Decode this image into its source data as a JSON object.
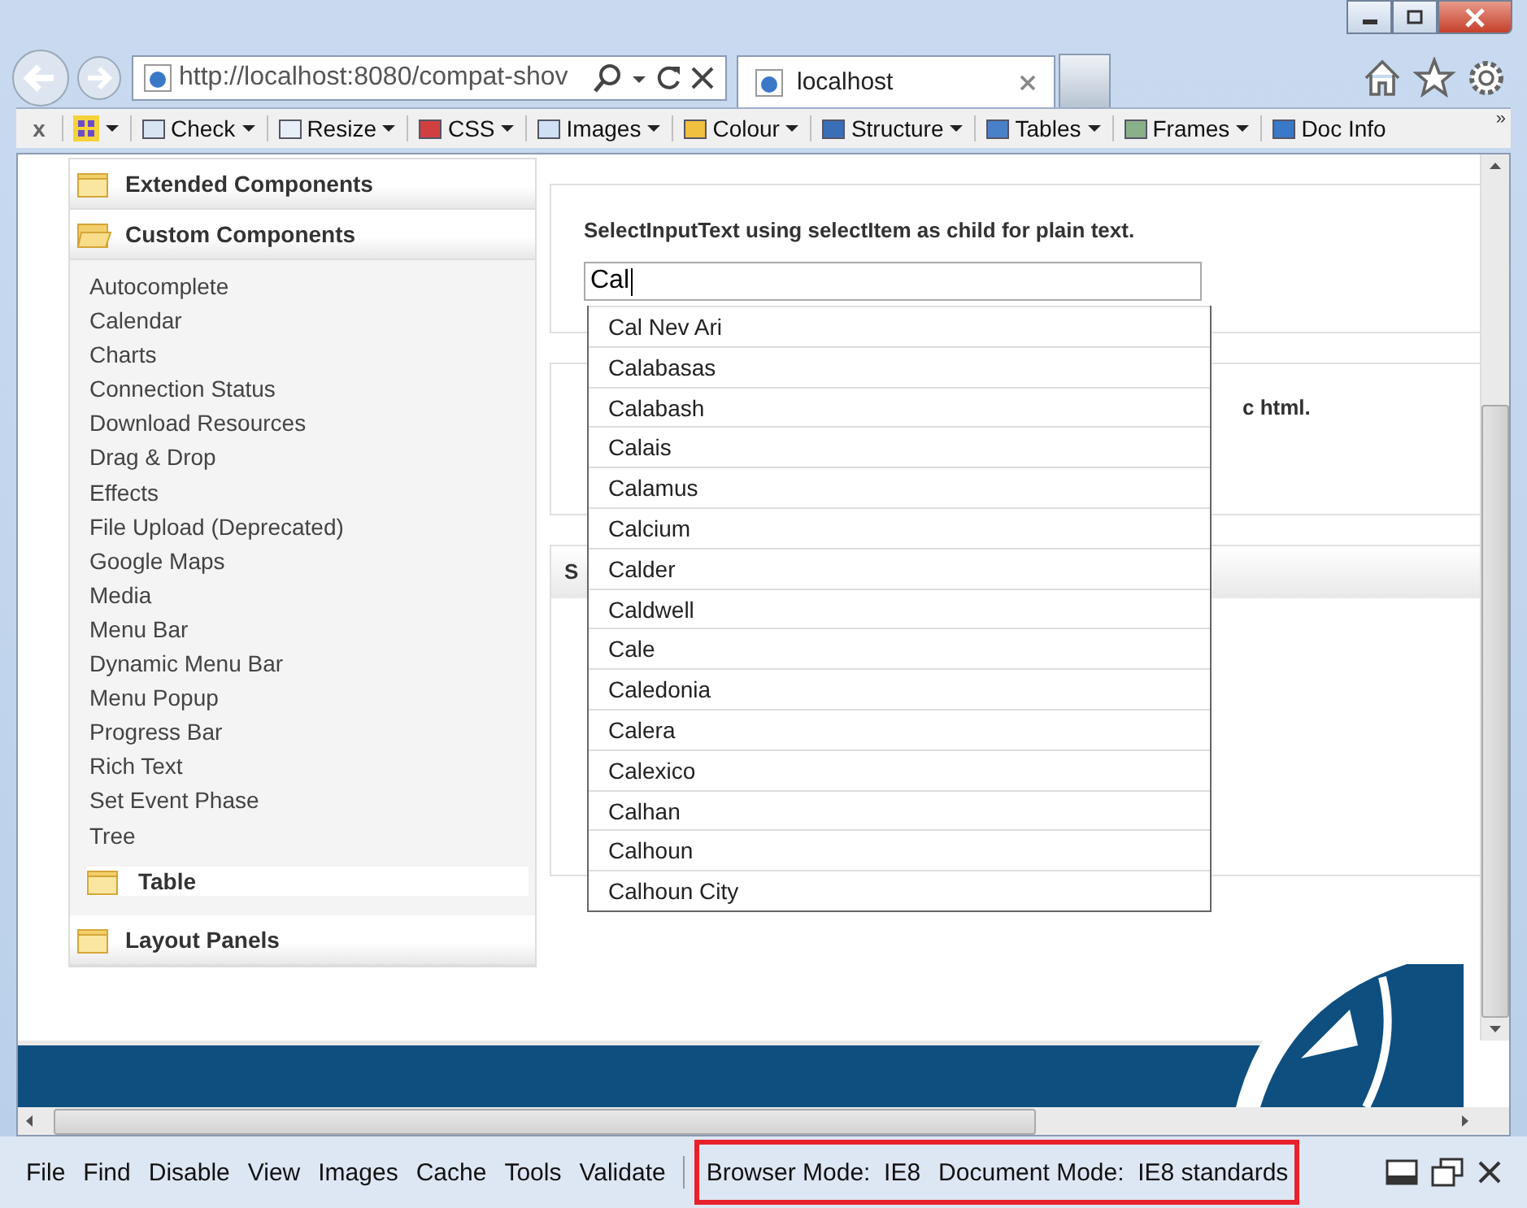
{
  "browser": {
    "address": "http://localhost:8080/compat-shov",
    "tab": {
      "title": "localhost",
      "selected": true
    }
  },
  "toolbar": {
    "close": "x",
    "items": [
      "Check",
      "Resize",
      "CSS",
      "Images",
      "Colour",
      "Structure",
      "Tables",
      "Frames",
      "Doc Info"
    ],
    "overflow": "»"
  },
  "sidebar": {
    "panels": [
      {
        "label": "Extended Components",
        "expanded": false
      },
      {
        "label": "Custom Components",
        "expanded": true,
        "children": [
          {
            "label": "Autocomplete"
          },
          {
            "label": "Calendar"
          },
          {
            "label": "Charts"
          },
          {
            "label": "Connection Status"
          },
          {
            "label": "Download Resources"
          },
          {
            "label": "Drag & Drop"
          },
          {
            "label": "Effects"
          },
          {
            "label": "File Upload (Deprecated)"
          },
          {
            "label": "Google Maps"
          },
          {
            "label": "Media"
          },
          {
            "label": "Menu Bar"
          },
          {
            "label": "Dynamic Menu Bar"
          },
          {
            "label": "Menu Popup"
          },
          {
            "label": "Progress Bar"
          },
          {
            "label": "Rich Text"
          },
          {
            "label": "Set Event Phase"
          },
          {
            "label": "Tree"
          }
        ],
        "subpanels": [
          {
            "label": "Table",
            "expanded": false
          }
        ]
      },
      {
        "label": "Layout Panels",
        "expanded": false
      }
    ]
  },
  "content": {
    "heading": "SelectInputText using selectItem as child for plain text.",
    "input": {
      "value": "Cal"
    },
    "suggestions": [
      "Cal Nev Ari",
      "Calabasas",
      "Calabash",
      "Calais",
      "Calamus",
      "Calcium",
      "Calder",
      "Caldwell",
      "Cale",
      "Caledonia",
      "Calera",
      "Calexico",
      "Calhan",
      "Calhoun",
      "Calhoun City"
    ],
    "second_heading": "c html.",
    "third_header": "S"
  },
  "devtools": {
    "menu": [
      "File",
      "Find",
      "Disable",
      "View",
      "Images",
      "Cache",
      "Tools",
      "Validate"
    ],
    "modes": [
      {
        "label": "Browser Mode:",
        "value": "IE8"
      },
      {
        "label": "Document Mode:",
        "value": "IE8 standards"
      }
    ],
    "highlighted": true
  }
}
